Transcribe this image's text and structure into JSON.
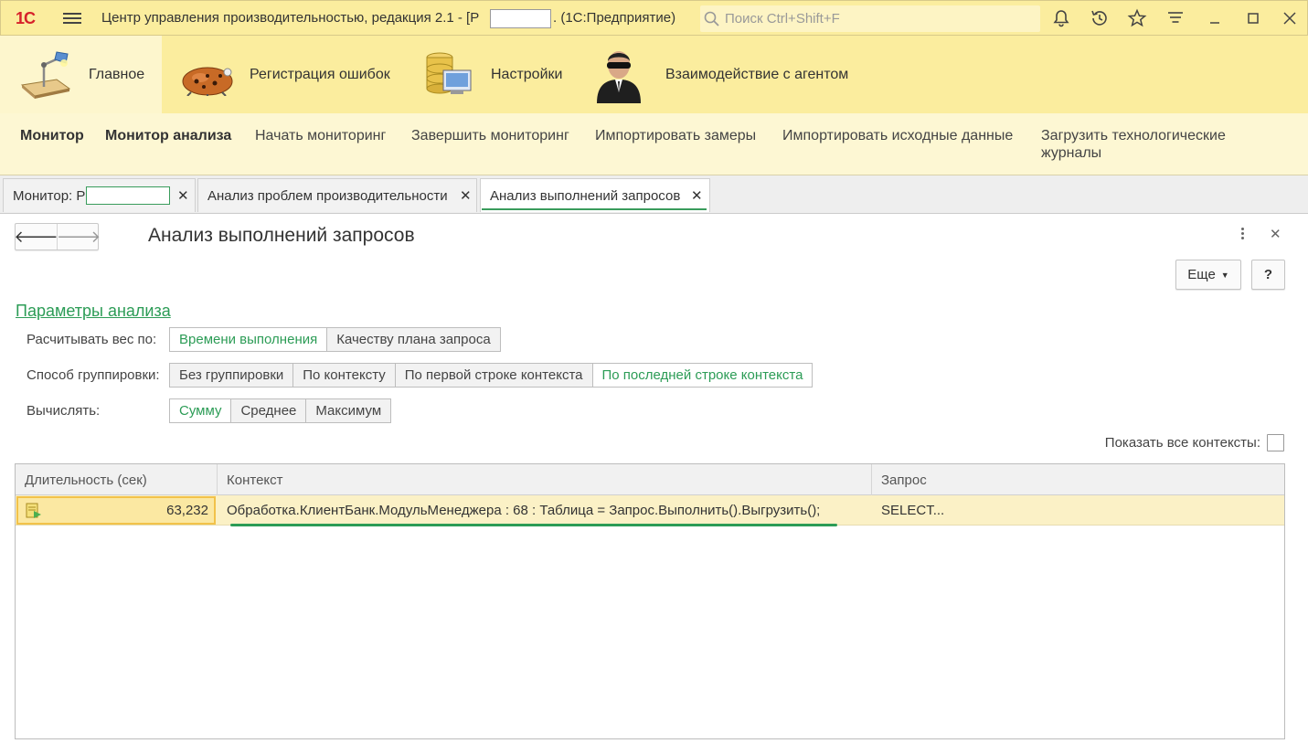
{
  "app": {
    "logo_text": "1С",
    "title_prefix": "Центр управления производительностью, редакция 2.1 - [Р",
    "title_suffix": ".  (1С:Предприятие)",
    "search_placeholder": "Поиск Ctrl+Shift+F"
  },
  "sections": [
    {
      "label": "Главное",
      "icon": "desk-lamp-icon",
      "active": true
    },
    {
      "label": "Регистрация ошибок",
      "icon": "bug-icon",
      "active": false
    },
    {
      "label": "Настройки",
      "icon": "database-settings-icon",
      "active": false
    },
    {
      "label": "Взаимодействие с агентом",
      "icon": "agent-icon",
      "active": false
    }
  ],
  "commands": [
    {
      "label": "Монитор",
      "bold": true
    },
    {
      "label": "Монитор анализа",
      "bold": true
    },
    {
      "label": "Начать мониторинг",
      "bold": false
    },
    {
      "label": "Завершить мониторинг",
      "bold": false
    },
    {
      "label": "Импортировать замеры",
      "bold": false
    },
    {
      "label": "Импортировать исходные данные",
      "bold": false
    },
    {
      "label": "Загрузить технологические",
      "bold": false
    },
    {
      "label": "журналы",
      "bold": false
    }
  ],
  "tabs": [
    {
      "label": "Монитор: Р",
      "active": false
    },
    {
      "label": "Анализ проблем производительности",
      "active": false
    },
    {
      "label": "Анализ выполнений запросов",
      "active": true
    }
  ],
  "form": {
    "title": "Анализ выполнений запросов",
    "more_label": "Еще",
    "help_label": "?",
    "params_link": "Параметры анализа",
    "weight_label": "Расчитывать вес по:",
    "weight_options": [
      "Времени выполнения",
      "Качеству плана запроса"
    ],
    "weight_selected": "Времени выполнения",
    "grouping_label": "Способ группировки:",
    "grouping_options": [
      "Без группировки",
      "По контексту",
      "По первой строке контекста",
      "По последней строке контекста"
    ],
    "grouping_selected": "По последней строке контекста",
    "calc_label": "Вычислять:",
    "calc_options": [
      "Сумму",
      "Среднее",
      "Максимум"
    ],
    "calc_selected": "Сумму",
    "show_all_label": "Показать все контексты:",
    "show_all_checked": false
  },
  "table": {
    "columns": [
      "Длительность (сек)",
      "Контекст",
      "Запрос"
    ],
    "rows": [
      {
        "duration": "63,232",
        "context": "Обработка.КлиентБанк.МодульМенеджера : 68 : Таблица = Запрос.Выполнить().Выгрузить();",
        "query": "SELECT..."
      }
    ]
  },
  "colors": {
    "title_bar_bg": "#fbed9e",
    "command_bar_bg": "#fdf7d3",
    "accent_green": "#2c9c56",
    "selected_row_bg": "#fbf1c6"
  }
}
